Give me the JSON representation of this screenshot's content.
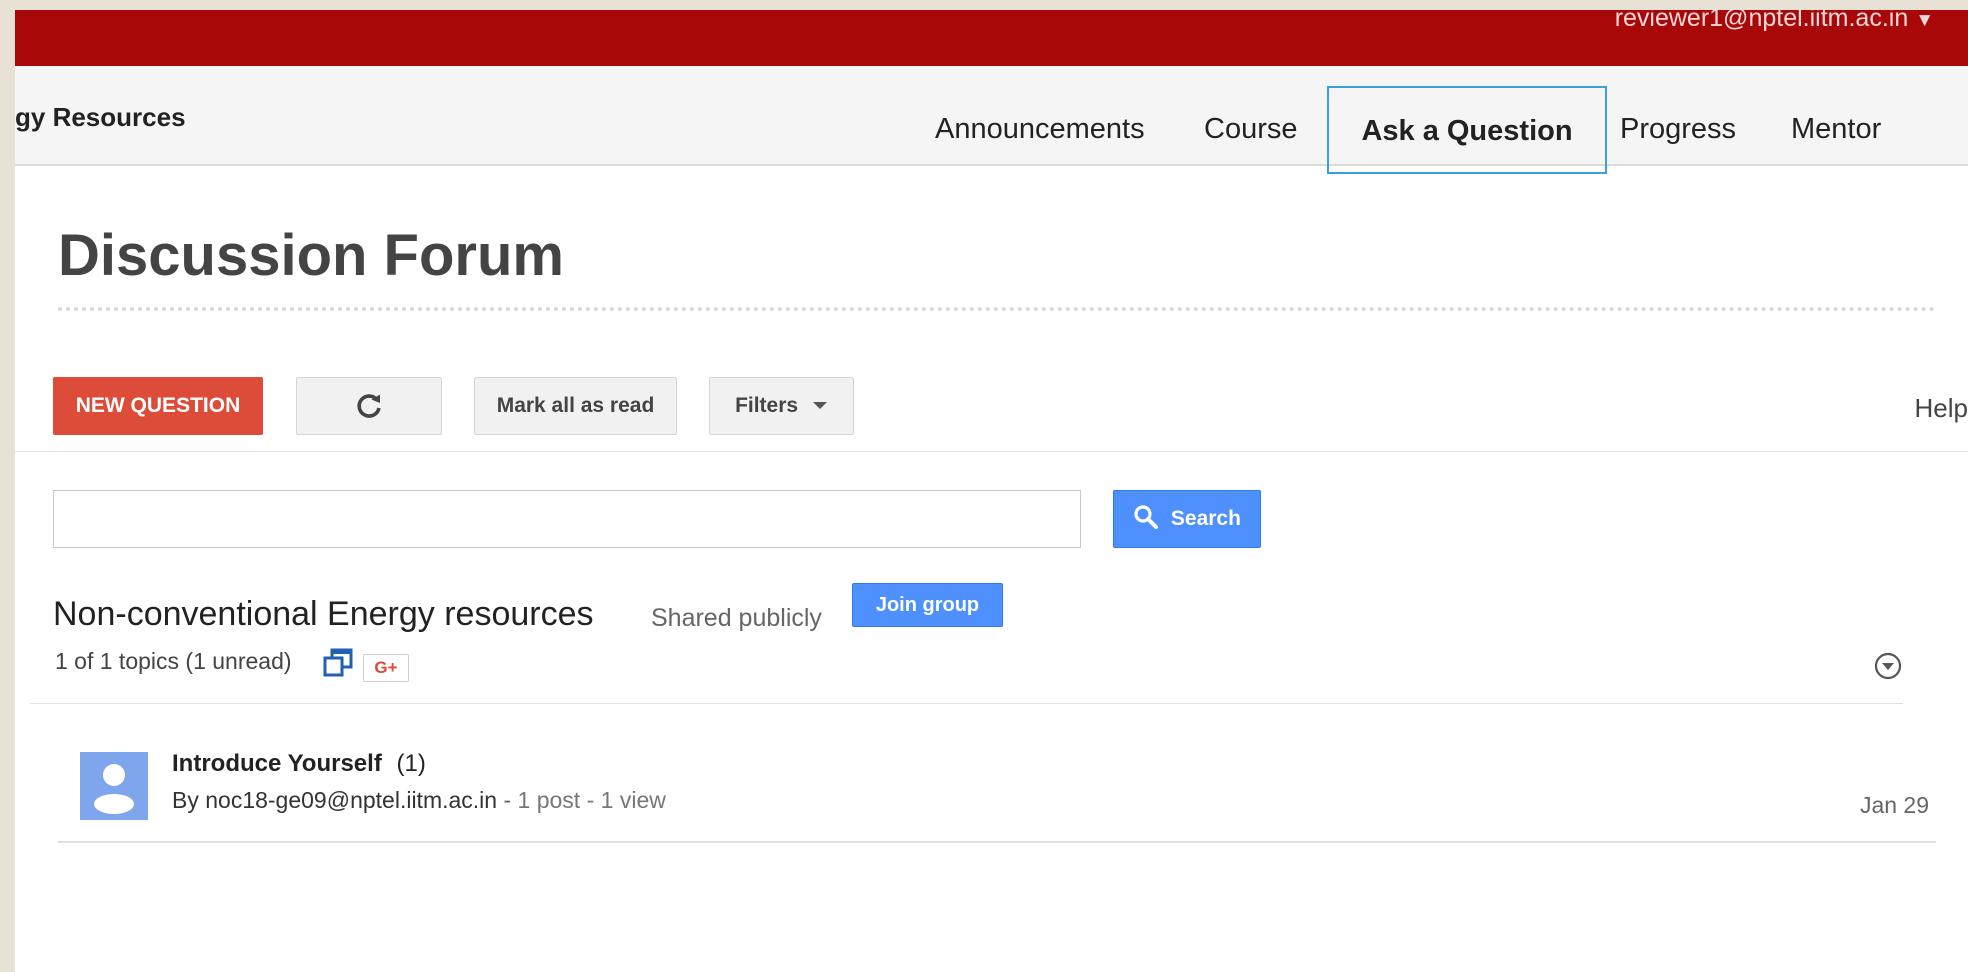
{
  "header": {
    "user_email": "reviewer1@nptel.iitm.ac.in",
    "user_menu_caret": "▼"
  },
  "nav": {
    "course_title": "gy Resources",
    "items": [
      {
        "label": "Announcements"
      },
      {
        "label": "Course"
      },
      {
        "label": "Ask a Question",
        "active": true
      },
      {
        "label": "Progress"
      },
      {
        "label": "Mentor"
      }
    ]
  },
  "forum": {
    "title": "Discussion Forum",
    "toolbar": {
      "new_question": "NEW QUESTION",
      "refresh_icon": "refresh-icon",
      "mark_all_read": "Mark all as read",
      "filters": "Filters",
      "help": "Help"
    },
    "search": {
      "value": "",
      "button_label": "Search"
    },
    "group": {
      "name": "Non-conventional Energy resources",
      "visibility": "Shared publicly",
      "join_label": "Join group",
      "topic_count": "1 of 1 topics (1 unread)",
      "gplus_label": "G+"
    },
    "topics": [
      {
        "title": "Introduce Yourself",
        "count": "(1)",
        "author_prefix": "By",
        "author": "noc18-ge09@nptel.iitm.ac.in",
        "separator": "-",
        "posts": "1 post",
        "views": "1 view",
        "date": "Jan 29"
      }
    ]
  },
  "colors": {
    "topbar": "#a80808",
    "new_question": "#dd4b39",
    "primary_blue": "#4d90fe",
    "active_nav_border": "#3aa0dd"
  }
}
